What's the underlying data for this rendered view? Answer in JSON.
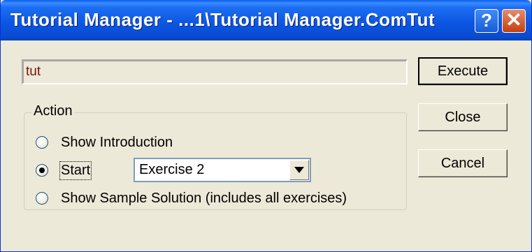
{
  "window": {
    "title": "Tutorial Manager - ...1\\Tutorial Manager.ComTut",
    "help_glyph": "?",
    "close_glyph": "✕"
  },
  "path_field": {
    "value": "tut"
  },
  "action": {
    "label": "Action",
    "options": [
      {
        "label": "Show Introduction",
        "checked": false
      },
      {
        "label": "Start",
        "checked": true
      },
      {
        "label": "Show Sample Solution (includes all exercises)",
        "checked": false
      }
    ],
    "exercise_select": {
      "value": "Exercise 2"
    }
  },
  "buttons": {
    "execute": "Execute",
    "close": "Close",
    "cancel": "Cancel"
  },
  "colors": {
    "titlebar": "#0A4BD2",
    "dialog_bg": "#ECE9D8",
    "path_text": "#7B1010",
    "close_button": "#C2400F"
  }
}
